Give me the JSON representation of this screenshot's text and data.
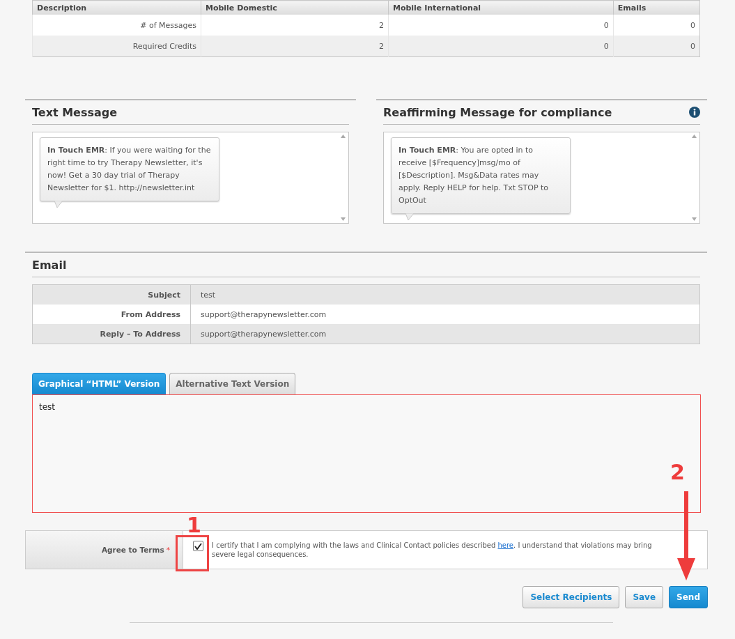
{
  "credits_table": {
    "columns": [
      "Description",
      "Mobile Domestic",
      "Mobile International",
      "Emails"
    ],
    "rows": [
      [
        "# of Messages",
        "2",
        "0",
        "0"
      ],
      [
        "Required Credits",
        "2",
        "0",
        "0"
      ]
    ]
  },
  "messages": [
    {
      "title": "Text Message",
      "info": false,
      "text": "**In Touch EMR**: If you were waiting for the right time to try Therapy Newsletter, it's now! Get a 30 day trial of Therapy Newsletter for $1. http://newsletter.int"
    },
    {
      "title": "Reaffirming Message for compliance",
      "info": true,
      "text": "**In Touch EMR**: You are opted in to receive [$Frequency]msg/mo of [$Description]. Msg&Data rates may apply. Reply HELP for help. Txt STOP to OptOut"
    }
  ],
  "email": {
    "title": "Email",
    "fields": [
      {
        "label": "Subject",
        "value": "test"
      },
      {
        "label": "From Address",
        "value": "support@therapynewsletter.com"
      },
      {
        "label": "Reply – To Address",
        "value": "support@therapynewsletter.com"
      }
    ]
  },
  "editor_tabs": [
    {
      "label": "Graphical “HTML” Version",
      "selected": true
    },
    {
      "label": "Alternative Text Version",
      "selected": false
    }
  ],
  "editor": {
    "value": "test"
  },
  "terms": {
    "label": "Agree to Terms",
    "required_mark": "*",
    "checked": true,
    "text_before": "I certify that I am complying with the laws and Clinical Contact policies described ",
    "link": "here",
    "text_after": ". I understand that violations may bring severe legal consequences."
  },
  "buttons": [
    {
      "label": "Select Recipients",
      "primary": false
    },
    {
      "label": "Save",
      "primary": false
    },
    {
      "label": "Send",
      "primary": true
    }
  ],
  "annotations": [
    {
      "label": "1",
      "kind": "box"
    },
    {
      "label": "2",
      "kind": "arrow"
    }
  ]
}
